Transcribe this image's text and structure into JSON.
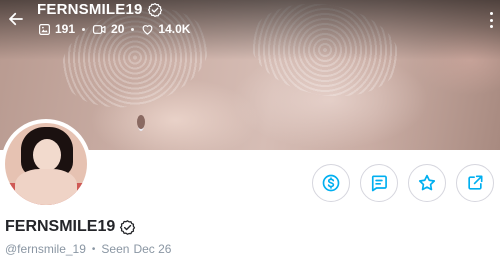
{
  "header": {
    "username": "FERNSMILE19",
    "stats": [
      {
        "icon": "image-icon",
        "value": "191"
      },
      {
        "icon": "video-icon",
        "value": "20"
      },
      {
        "icon": "heart-icon",
        "value": "14.0K"
      }
    ]
  },
  "actions": [
    {
      "icon": "dollar-icon",
      "label": "tip"
    },
    {
      "icon": "message-icon",
      "label": "message"
    },
    {
      "icon": "star-icon",
      "label": "favorite"
    },
    {
      "icon": "share-icon",
      "label": "share"
    }
  ],
  "profile": {
    "display_name": "FERNSMILE19",
    "handle": "@fernsmile_19",
    "separator": "•",
    "seen_label": "Seen",
    "seen_date": "Dec 26"
  },
  "colors": {
    "accent": "#00aff0",
    "text_primary": "#242529",
    "text_secondary": "#8a96a3",
    "button_border": "#d6d6de"
  }
}
